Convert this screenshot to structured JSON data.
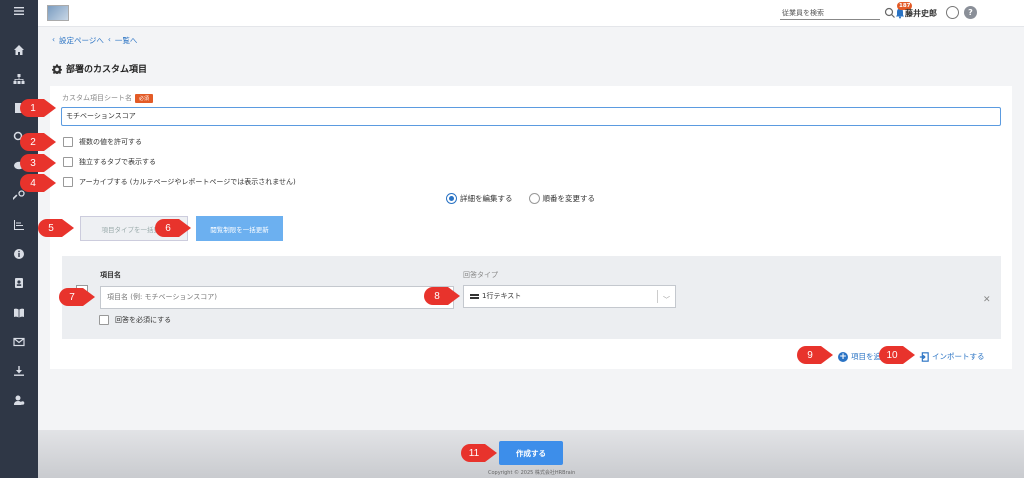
{
  "header": {
    "search_placeholder": "従業員を検索",
    "notification_count": "187",
    "user_name": "藤井史郎",
    "help_label": "?"
  },
  "sidebar": {
    "icons": [
      "menu-icon",
      "home-icon",
      "org-chart-icon",
      "document-icon",
      "search-icon",
      "chat-icon",
      "wrench-icon",
      "chart-icon",
      "info-icon",
      "contact-card-icon",
      "book-icon",
      "mail-icon",
      "download-icon",
      "user-settings-icon"
    ]
  },
  "breadcrumb": {
    "back_settings": "設定ページへ",
    "back_list": "一覧へ"
  },
  "page": {
    "title": "部署のカスタム項目"
  },
  "form": {
    "sheet_name_label": "カスタム項目シート名",
    "required_badge": "必須",
    "sheet_name_value": "モチベーションスコア",
    "allow_multiple": "複数の値を許可する",
    "separate_tab": "独立するタブで表示する",
    "archive": "アーカイブする (カルテページやレポートページでは表示されません)",
    "radio_edit": "詳細を編集する",
    "radio_order": "順番を変更する",
    "btn_bulk_type": "項目タイプを一括更新",
    "btn_bulk_view": "閲覧制限を一括更新",
    "item_name_header": "項目名",
    "answer_type_header": "回答タイプ",
    "item_name_placeholder": "項目名 (例: モチベーションスコア)",
    "answer_type_value": "1行テキスト",
    "make_required": "回答を必須にする",
    "add_item": "項目を追加",
    "import": "インポートする",
    "create": "作成する",
    "copyright": "Copyright © 2025 株式会社HRBrain"
  },
  "markers": [
    "1",
    "2",
    "3",
    "4",
    "5",
    "6",
    "7",
    "8",
    "9",
    "10",
    "11"
  ],
  "colors": {
    "sidebar": "#2f3746",
    "accent": "#2a73c4",
    "primary_button": "#3d8eea",
    "marker": "#e8332c"
  }
}
